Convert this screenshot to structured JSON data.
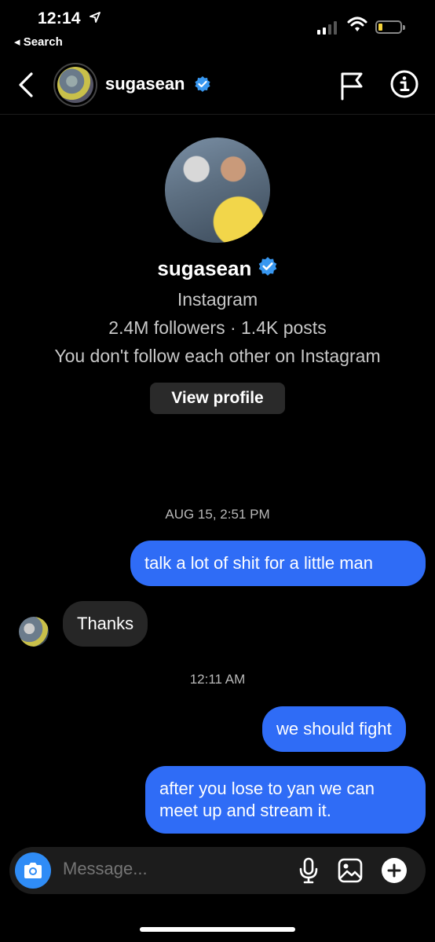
{
  "status_bar": {
    "time": "12:14",
    "back_label": "◂ Search"
  },
  "header": {
    "username": "sugasean",
    "verified_color": "#3897f0"
  },
  "profile": {
    "name": "sugasean",
    "platform": "Instagram",
    "stats": "2.4M followers · 1.4K posts",
    "relation": "You don't follow each other on Instagram",
    "view_button": "View profile"
  },
  "messages": [
    {
      "type": "timestamp",
      "text": "AUG 15, 2:51 PM"
    },
    {
      "type": "sent",
      "text": "talk a lot of shit for a little man"
    },
    {
      "type": "received",
      "text": "Thanks"
    },
    {
      "type": "timestamp",
      "text": "12:11 AM"
    },
    {
      "type": "sent",
      "text": "we should fight"
    },
    {
      "type": "sent",
      "text": "after you lose to yan we can meet up and stream it."
    }
  ],
  "composer": {
    "placeholder": "Message...",
    "accent": "#2f8cf6"
  },
  "colors": {
    "sent_bubble": "#2f6cf6",
    "received_bubble": "#262626",
    "background": "#000000"
  }
}
